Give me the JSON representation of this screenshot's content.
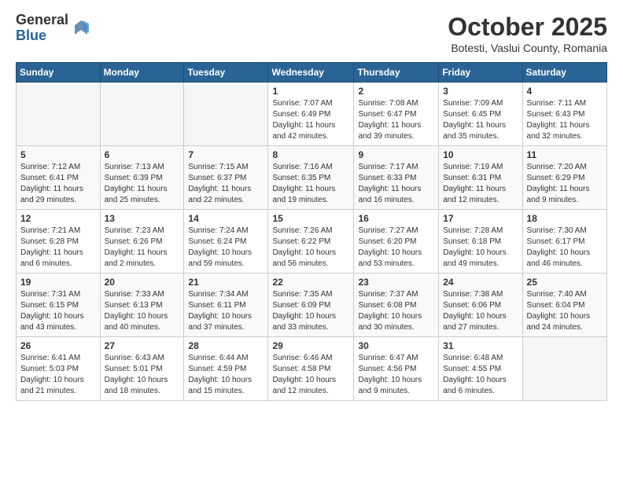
{
  "logo": {
    "general": "General",
    "blue": "Blue"
  },
  "header": {
    "month": "October 2025",
    "location": "Botesti, Vaslui County, Romania"
  },
  "weekdays": [
    "Sunday",
    "Monday",
    "Tuesday",
    "Wednesday",
    "Thursday",
    "Friday",
    "Saturday"
  ],
  "weeks": [
    [
      {
        "day": "",
        "info": ""
      },
      {
        "day": "",
        "info": ""
      },
      {
        "day": "",
        "info": ""
      },
      {
        "day": "1",
        "info": "Sunrise: 7:07 AM\nSunset: 6:49 PM\nDaylight: 11 hours\nand 42 minutes."
      },
      {
        "day": "2",
        "info": "Sunrise: 7:08 AM\nSunset: 6:47 PM\nDaylight: 11 hours\nand 39 minutes."
      },
      {
        "day": "3",
        "info": "Sunrise: 7:09 AM\nSunset: 6:45 PM\nDaylight: 11 hours\nand 35 minutes."
      },
      {
        "day": "4",
        "info": "Sunrise: 7:11 AM\nSunset: 6:43 PM\nDaylight: 11 hours\nand 32 minutes."
      }
    ],
    [
      {
        "day": "5",
        "info": "Sunrise: 7:12 AM\nSunset: 6:41 PM\nDaylight: 11 hours\nand 29 minutes."
      },
      {
        "day": "6",
        "info": "Sunrise: 7:13 AM\nSunset: 6:39 PM\nDaylight: 11 hours\nand 25 minutes."
      },
      {
        "day": "7",
        "info": "Sunrise: 7:15 AM\nSunset: 6:37 PM\nDaylight: 11 hours\nand 22 minutes."
      },
      {
        "day": "8",
        "info": "Sunrise: 7:16 AM\nSunset: 6:35 PM\nDaylight: 11 hours\nand 19 minutes."
      },
      {
        "day": "9",
        "info": "Sunrise: 7:17 AM\nSunset: 6:33 PM\nDaylight: 11 hours\nand 16 minutes."
      },
      {
        "day": "10",
        "info": "Sunrise: 7:19 AM\nSunset: 6:31 PM\nDaylight: 11 hours\nand 12 minutes."
      },
      {
        "day": "11",
        "info": "Sunrise: 7:20 AM\nSunset: 6:29 PM\nDaylight: 11 hours\nand 9 minutes."
      }
    ],
    [
      {
        "day": "12",
        "info": "Sunrise: 7:21 AM\nSunset: 6:28 PM\nDaylight: 11 hours\nand 6 minutes."
      },
      {
        "day": "13",
        "info": "Sunrise: 7:23 AM\nSunset: 6:26 PM\nDaylight: 11 hours\nand 2 minutes."
      },
      {
        "day": "14",
        "info": "Sunrise: 7:24 AM\nSunset: 6:24 PM\nDaylight: 10 hours\nand 59 minutes."
      },
      {
        "day": "15",
        "info": "Sunrise: 7:26 AM\nSunset: 6:22 PM\nDaylight: 10 hours\nand 56 minutes."
      },
      {
        "day": "16",
        "info": "Sunrise: 7:27 AM\nSunset: 6:20 PM\nDaylight: 10 hours\nand 53 minutes."
      },
      {
        "day": "17",
        "info": "Sunrise: 7:28 AM\nSunset: 6:18 PM\nDaylight: 10 hours\nand 49 minutes."
      },
      {
        "day": "18",
        "info": "Sunrise: 7:30 AM\nSunset: 6:17 PM\nDaylight: 10 hours\nand 46 minutes."
      }
    ],
    [
      {
        "day": "19",
        "info": "Sunrise: 7:31 AM\nSunset: 6:15 PM\nDaylight: 10 hours\nand 43 minutes."
      },
      {
        "day": "20",
        "info": "Sunrise: 7:33 AM\nSunset: 6:13 PM\nDaylight: 10 hours\nand 40 minutes."
      },
      {
        "day": "21",
        "info": "Sunrise: 7:34 AM\nSunset: 6:11 PM\nDaylight: 10 hours\nand 37 minutes."
      },
      {
        "day": "22",
        "info": "Sunrise: 7:35 AM\nSunset: 6:09 PM\nDaylight: 10 hours\nand 33 minutes."
      },
      {
        "day": "23",
        "info": "Sunrise: 7:37 AM\nSunset: 6:08 PM\nDaylight: 10 hours\nand 30 minutes."
      },
      {
        "day": "24",
        "info": "Sunrise: 7:38 AM\nSunset: 6:06 PM\nDaylight: 10 hours\nand 27 minutes."
      },
      {
        "day": "25",
        "info": "Sunrise: 7:40 AM\nSunset: 6:04 PM\nDaylight: 10 hours\nand 24 minutes."
      }
    ],
    [
      {
        "day": "26",
        "info": "Sunrise: 6:41 AM\nSunset: 5:03 PM\nDaylight: 10 hours\nand 21 minutes."
      },
      {
        "day": "27",
        "info": "Sunrise: 6:43 AM\nSunset: 5:01 PM\nDaylight: 10 hours\nand 18 minutes."
      },
      {
        "day": "28",
        "info": "Sunrise: 6:44 AM\nSunset: 4:59 PM\nDaylight: 10 hours\nand 15 minutes."
      },
      {
        "day": "29",
        "info": "Sunrise: 6:46 AM\nSunset: 4:58 PM\nDaylight: 10 hours\nand 12 minutes."
      },
      {
        "day": "30",
        "info": "Sunrise: 6:47 AM\nSunset: 4:56 PM\nDaylight: 10 hours\nand 9 minutes."
      },
      {
        "day": "31",
        "info": "Sunrise: 6:48 AM\nSunset: 4:55 PM\nDaylight: 10 hours\nand 6 minutes."
      },
      {
        "day": "",
        "info": ""
      }
    ]
  ]
}
